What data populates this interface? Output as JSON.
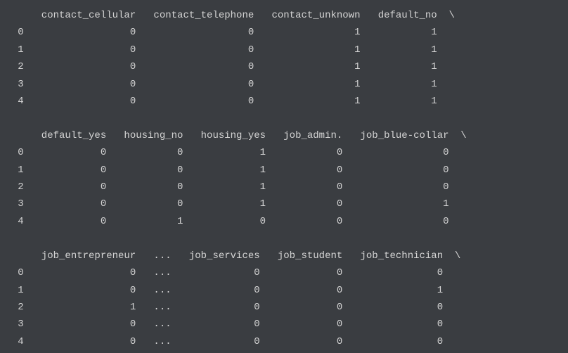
{
  "blocks": [
    {
      "index_header": "",
      "columns": [
        "contact_cellular",
        "contact_telephone",
        "contact_unknown",
        "default_no"
      ],
      "continuation": "\\",
      "rows": [
        {
          "idx": "0",
          "values": [
            "0",
            "0",
            "1",
            "1"
          ]
        },
        {
          "idx": "1",
          "values": [
            "0",
            "0",
            "1",
            "1"
          ]
        },
        {
          "idx": "2",
          "values": [
            "0",
            "0",
            "1",
            "1"
          ]
        },
        {
          "idx": "3",
          "values": [
            "0",
            "0",
            "1",
            "1"
          ]
        },
        {
          "idx": "4",
          "values": [
            "0",
            "0",
            "1",
            "1"
          ]
        }
      ]
    },
    {
      "index_header": "",
      "columns": [
        "default_yes",
        "housing_no",
        "housing_yes",
        "job_admin.",
        "job_blue-collar"
      ],
      "continuation": "\\",
      "rows": [
        {
          "idx": "0",
          "values": [
            "0",
            "0",
            "1",
            "0",
            "0"
          ]
        },
        {
          "idx": "1",
          "values": [
            "0",
            "0",
            "1",
            "0",
            "0"
          ]
        },
        {
          "idx": "2",
          "values": [
            "0",
            "0",
            "1",
            "0",
            "0"
          ]
        },
        {
          "idx": "3",
          "values": [
            "0",
            "0",
            "1",
            "0",
            "1"
          ]
        },
        {
          "idx": "4",
          "values": [
            "0",
            "1",
            "0",
            "0",
            "0"
          ]
        }
      ]
    },
    {
      "index_header": "",
      "columns": [
        "job_entrepreneur",
        "...",
        "job_services",
        "job_student",
        "job_technician"
      ],
      "continuation": "\\",
      "rows": [
        {
          "idx": "0",
          "values": [
            "0",
            "...",
            "0",
            "0",
            "0"
          ]
        },
        {
          "idx": "1",
          "values": [
            "0",
            "...",
            "0",
            "0",
            "1"
          ]
        },
        {
          "idx": "2",
          "values": [
            "1",
            "...",
            "0",
            "0",
            "0"
          ]
        },
        {
          "idx": "3",
          "values": [
            "0",
            "...",
            "0",
            "0",
            "0"
          ]
        },
        {
          "idx": "4",
          "values": [
            "0",
            "...",
            "0",
            "0",
            "0"
          ]
        }
      ]
    }
  ],
  "chart_data": {
    "type": "table",
    "title": "One-hot encoded dataframe head (first 5 rows, column-wrapped)",
    "index": [
      0,
      1,
      2,
      3,
      4
    ],
    "columns_shown": [
      "contact_cellular",
      "contact_telephone",
      "contact_unknown",
      "default_no",
      "default_yes",
      "housing_no",
      "housing_yes",
      "job_admin.",
      "job_blue-collar",
      "job_entrepreneur",
      "...",
      "job_services",
      "job_student",
      "job_technician"
    ],
    "data": [
      {
        "contact_cellular": 0,
        "contact_telephone": 0,
        "contact_unknown": 1,
        "default_no": 1,
        "default_yes": 0,
        "housing_no": 0,
        "housing_yes": 1,
        "job_admin.": 0,
        "job_blue-collar": 0,
        "job_entrepreneur": 0,
        "job_services": 0,
        "job_student": 0,
        "job_technician": 0
      },
      {
        "contact_cellular": 0,
        "contact_telephone": 0,
        "contact_unknown": 1,
        "default_no": 1,
        "default_yes": 0,
        "housing_no": 0,
        "housing_yes": 1,
        "job_admin.": 0,
        "job_blue-collar": 0,
        "job_entrepreneur": 0,
        "job_services": 0,
        "job_student": 0,
        "job_technician": 1
      },
      {
        "contact_cellular": 0,
        "contact_telephone": 0,
        "contact_unknown": 1,
        "default_no": 1,
        "default_yes": 0,
        "housing_no": 0,
        "housing_yes": 1,
        "job_admin.": 0,
        "job_blue-collar": 0,
        "job_entrepreneur": 1,
        "job_services": 0,
        "job_student": 0,
        "job_technician": 0
      },
      {
        "contact_cellular": 0,
        "contact_telephone": 0,
        "contact_unknown": 1,
        "default_no": 1,
        "default_yes": 0,
        "housing_no": 0,
        "housing_yes": 1,
        "job_admin.": 0,
        "job_blue-collar": 1,
        "job_entrepreneur": 0,
        "job_services": 0,
        "job_student": 0,
        "job_technician": 0
      },
      {
        "contact_cellular": 0,
        "contact_telephone": 0,
        "contact_unknown": 1,
        "default_no": 1,
        "default_yes": 0,
        "housing_no": 1,
        "housing_yes": 0,
        "job_admin.": 0,
        "job_blue-collar": 0,
        "job_entrepreneur": 0,
        "job_services": 0,
        "job_student": 0,
        "job_technician": 0
      }
    ]
  }
}
